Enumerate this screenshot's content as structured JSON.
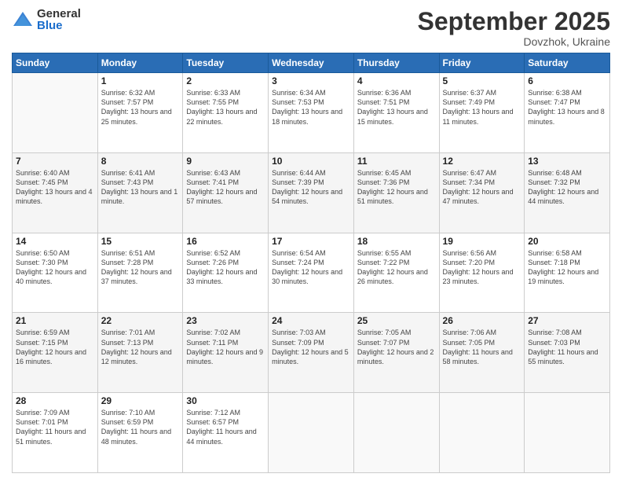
{
  "logo": {
    "general": "General",
    "blue": "Blue"
  },
  "header": {
    "month": "September 2025",
    "location": "Dovzhok, Ukraine"
  },
  "days_header": [
    "Sunday",
    "Monday",
    "Tuesday",
    "Wednesday",
    "Thursday",
    "Friday",
    "Saturday"
  ],
  "weeks": [
    [
      {
        "day": "",
        "sunrise": "",
        "sunset": "",
        "daylight": ""
      },
      {
        "day": "1",
        "sunrise": "Sunrise: 6:32 AM",
        "sunset": "Sunset: 7:57 PM",
        "daylight": "Daylight: 13 hours and 25 minutes."
      },
      {
        "day": "2",
        "sunrise": "Sunrise: 6:33 AM",
        "sunset": "Sunset: 7:55 PM",
        "daylight": "Daylight: 13 hours and 22 minutes."
      },
      {
        "day": "3",
        "sunrise": "Sunrise: 6:34 AM",
        "sunset": "Sunset: 7:53 PM",
        "daylight": "Daylight: 13 hours and 18 minutes."
      },
      {
        "day": "4",
        "sunrise": "Sunrise: 6:36 AM",
        "sunset": "Sunset: 7:51 PM",
        "daylight": "Daylight: 13 hours and 15 minutes."
      },
      {
        "day": "5",
        "sunrise": "Sunrise: 6:37 AM",
        "sunset": "Sunset: 7:49 PM",
        "daylight": "Daylight: 13 hours and 11 minutes."
      },
      {
        "day": "6",
        "sunrise": "Sunrise: 6:38 AM",
        "sunset": "Sunset: 7:47 PM",
        "daylight": "Daylight: 13 hours and 8 minutes."
      }
    ],
    [
      {
        "day": "7",
        "sunrise": "Sunrise: 6:40 AM",
        "sunset": "Sunset: 7:45 PM",
        "daylight": "Daylight: 13 hours and 4 minutes."
      },
      {
        "day": "8",
        "sunrise": "Sunrise: 6:41 AM",
        "sunset": "Sunset: 7:43 PM",
        "daylight": "Daylight: 13 hours and 1 minute."
      },
      {
        "day": "9",
        "sunrise": "Sunrise: 6:43 AM",
        "sunset": "Sunset: 7:41 PM",
        "daylight": "Daylight: 12 hours and 57 minutes."
      },
      {
        "day": "10",
        "sunrise": "Sunrise: 6:44 AM",
        "sunset": "Sunset: 7:39 PM",
        "daylight": "Daylight: 12 hours and 54 minutes."
      },
      {
        "day": "11",
        "sunrise": "Sunrise: 6:45 AM",
        "sunset": "Sunset: 7:36 PM",
        "daylight": "Daylight: 12 hours and 51 minutes."
      },
      {
        "day": "12",
        "sunrise": "Sunrise: 6:47 AM",
        "sunset": "Sunset: 7:34 PM",
        "daylight": "Daylight: 12 hours and 47 minutes."
      },
      {
        "day": "13",
        "sunrise": "Sunrise: 6:48 AM",
        "sunset": "Sunset: 7:32 PM",
        "daylight": "Daylight: 12 hours and 44 minutes."
      }
    ],
    [
      {
        "day": "14",
        "sunrise": "Sunrise: 6:50 AM",
        "sunset": "Sunset: 7:30 PM",
        "daylight": "Daylight: 12 hours and 40 minutes."
      },
      {
        "day": "15",
        "sunrise": "Sunrise: 6:51 AM",
        "sunset": "Sunset: 7:28 PM",
        "daylight": "Daylight: 12 hours and 37 minutes."
      },
      {
        "day": "16",
        "sunrise": "Sunrise: 6:52 AM",
        "sunset": "Sunset: 7:26 PM",
        "daylight": "Daylight: 12 hours and 33 minutes."
      },
      {
        "day": "17",
        "sunrise": "Sunrise: 6:54 AM",
        "sunset": "Sunset: 7:24 PM",
        "daylight": "Daylight: 12 hours and 30 minutes."
      },
      {
        "day": "18",
        "sunrise": "Sunrise: 6:55 AM",
        "sunset": "Sunset: 7:22 PM",
        "daylight": "Daylight: 12 hours and 26 minutes."
      },
      {
        "day": "19",
        "sunrise": "Sunrise: 6:56 AM",
        "sunset": "Sunset: 7:20 PM",
        "daylight": "Daylight: 12 hours and 23 minutes."
      },
      {
        "day": "20",
        "sunrise": "Sunrise: 6:58 AM",
        "sunset": "Sunset: 7:18 PM",
        "daylight": "Daylight: 12 hours and 19 minutes."
      }
    ],
    [
      {
        "day": "21",
        "sunrise": "Sunrise: 6:59 AM",
        "sunset": "Sunset: 7:15 PM",
        "daylight": "Daylight: 12 hours and 16 minutes."
      },
      {
        "day": "22",
        "sunrise": "Sunrise: 7:01 AM",
        "sunset": "Sunset: 7:13 PM",
        "daylight": "Daylight: 12 hours and 12 minutes."
      },
      {
        "day": "23",
        "sunrise": "Sunrise: 7:02 AM",
        "sunset": "Sunset: 7:11 PM",
        "daylight": "Daylight: 12 hours and 9 minutes."
      },
      {
        "day": "24",
        "sunrise": "Sunrise: 7:03 AM",
        "sunset": "Sunset: 7:09 PM",
        "daylight": "Daylight: 12 hours and 5 minutes."
      },
      {
        "day": "25",
        "sunrise": "Sunrise: 7:05 AM",
        "sunset": "Sunset: 7:07 PM",
        "daylight": "Daylight: 12 hours and 2 minutes."
      },
      {
        "day": "26",
        "sunrise": "Sunrise: 7:06 AM",
        "sunset": "Sunset: 7:05 PM",
        "daylight": "Daylight: 11 hours and 58 minutes."
      },
      {
        "day": "27",
        "sunrise": "Sunrise: 7:08 AM",
        "sunset": "Sunset: 7:03 PM",
        "daylight": "Daylight: 11 hours and 55 minutes."
      }
    ],
    [
      {
        "day": "28",
        "sunrise": "Sunrise: 7:09 AM",
        "sunset": "Sunset: 7:01 PM",
        "daylight": "Daylight: 11 hours and 51 minutes."
      },
      {
        "day": "29",
        "sunrise": "Sunrise: 7:10 AM",
        "sunset": "Sunset: 6:59 PM",
        "daylight": "Daylight: 11 hours and 48 minutes."
      },
      {
        "day": "30",
        "sunrise": "Sunrise: 7:12 AM",
        "sunset": "Sunset: 6:57 PM",
        "daylight": "Daylight: 11 hours and 44 minutes."
      },
      {
        "day": "",
        "sunrise": "",
        "sunset": "",
        "daylight": ""
      },
      {
        "day": "",
        "sunrise": "",
        "sunset": "",
        "daylight": ""
      },
      {
        "day": "",
        "sunrise": "",
        "sunset": "",
        "daylight": ""
      },
      {
        "day": "",
        "sunrise": "",
        "sunset": "",
        "daylight": ""
      }
    ]
  ]
}
